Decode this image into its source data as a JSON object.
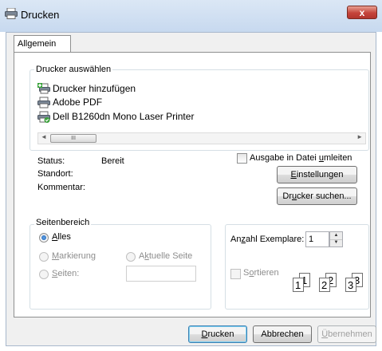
{
  "window": {
    "title": "Drucken",
    "close_glyph": "x"
  },
  "tabs": [
    {
      "label": "Allgemein",
      "active": true
    }
  ],
  "printer_select": {
    "legend": "Drucker auswählen",
    "items": [
      {
        "label": "Drucker hinzufügen",
        "icon": "add-printer-icon"
      },
      {
        "label": "Adobe PDF",
        "icon": "printer-icon"
      },
      {
        "label": "Dell B1260dn Mono Laser Printer",
        "icon": "default-printer-icon"
      }
    ],
    "scrollbar": {
      "left_arrow": "◄",
      "right_arrow": "►",
      "thumb_grip": "III"
    }
  },
  "status": {
    "status_label": "Status:",
    "status_value": "Bereit",
    "location_label": "Standort:",
    "location_value": "",
    "comment_label": "Kommentar:",
    "comment_value": "",
    "print_to_file": {
      "pre": "Ausgabe in Datei ",
      "ul": "u",
      "post": "mleiten",
      "checked": false
    },
    "settings_button": {
      "ul": "E",
      "post": "instellungen"
    },
    "find_printer_button": {
      "pre": "Dr",
      "ul": "u",
      "post": "cker suchen..."
    }
  },
  "page_range": {
    "legend": "Seitenbereich",
    "all": {
      "ul": "A",
      "post": "lles",
      "selected": true
    },
    "selection": {
      "ul": "M",
      "post": "arkierung",
      "enabled": false
    },
    "current_page": {
      "pre": "A",
      "ul": "k",
      "post": "tuelle Seite",
      "enabled": false
    },
    "pages": {
      "ul": "S",
      "post": "eiten:",
      "enabled": false,
      "value": ""
    }
  },
  "copies": {
    "label_pre": "An",
    "label_ul": "z",
    "label_post": "ahl Exemplare:",
    "value": "1",
    "spin_up": "▲",
    "spin_down": "▼",
    "collate": {
      "pre": "S",
      "ul": "o",
      "post": "rtieren",
      "checked": false,
      "enabled": false
    },
    "collate_pages": [
      "1",
      "1",
      "2",
      "2",
      "3",
      "3"
    ]
  },
  "buttons": {
    "print": {
      "ul": "D",
      "post": "rucken"
    },
    "cancel": {
      "label": "Abbrechen"
    },
    "apply": {
      "ul": "Ü",
      "post": "bernehmen",
      "enabled": false
    }
  },
  "colors": {
    "title_gradient_top": "#dbe7f5",
    "close_red": "#c5443a",
    "default_button_border": "#3c7fb1"
  }
}
